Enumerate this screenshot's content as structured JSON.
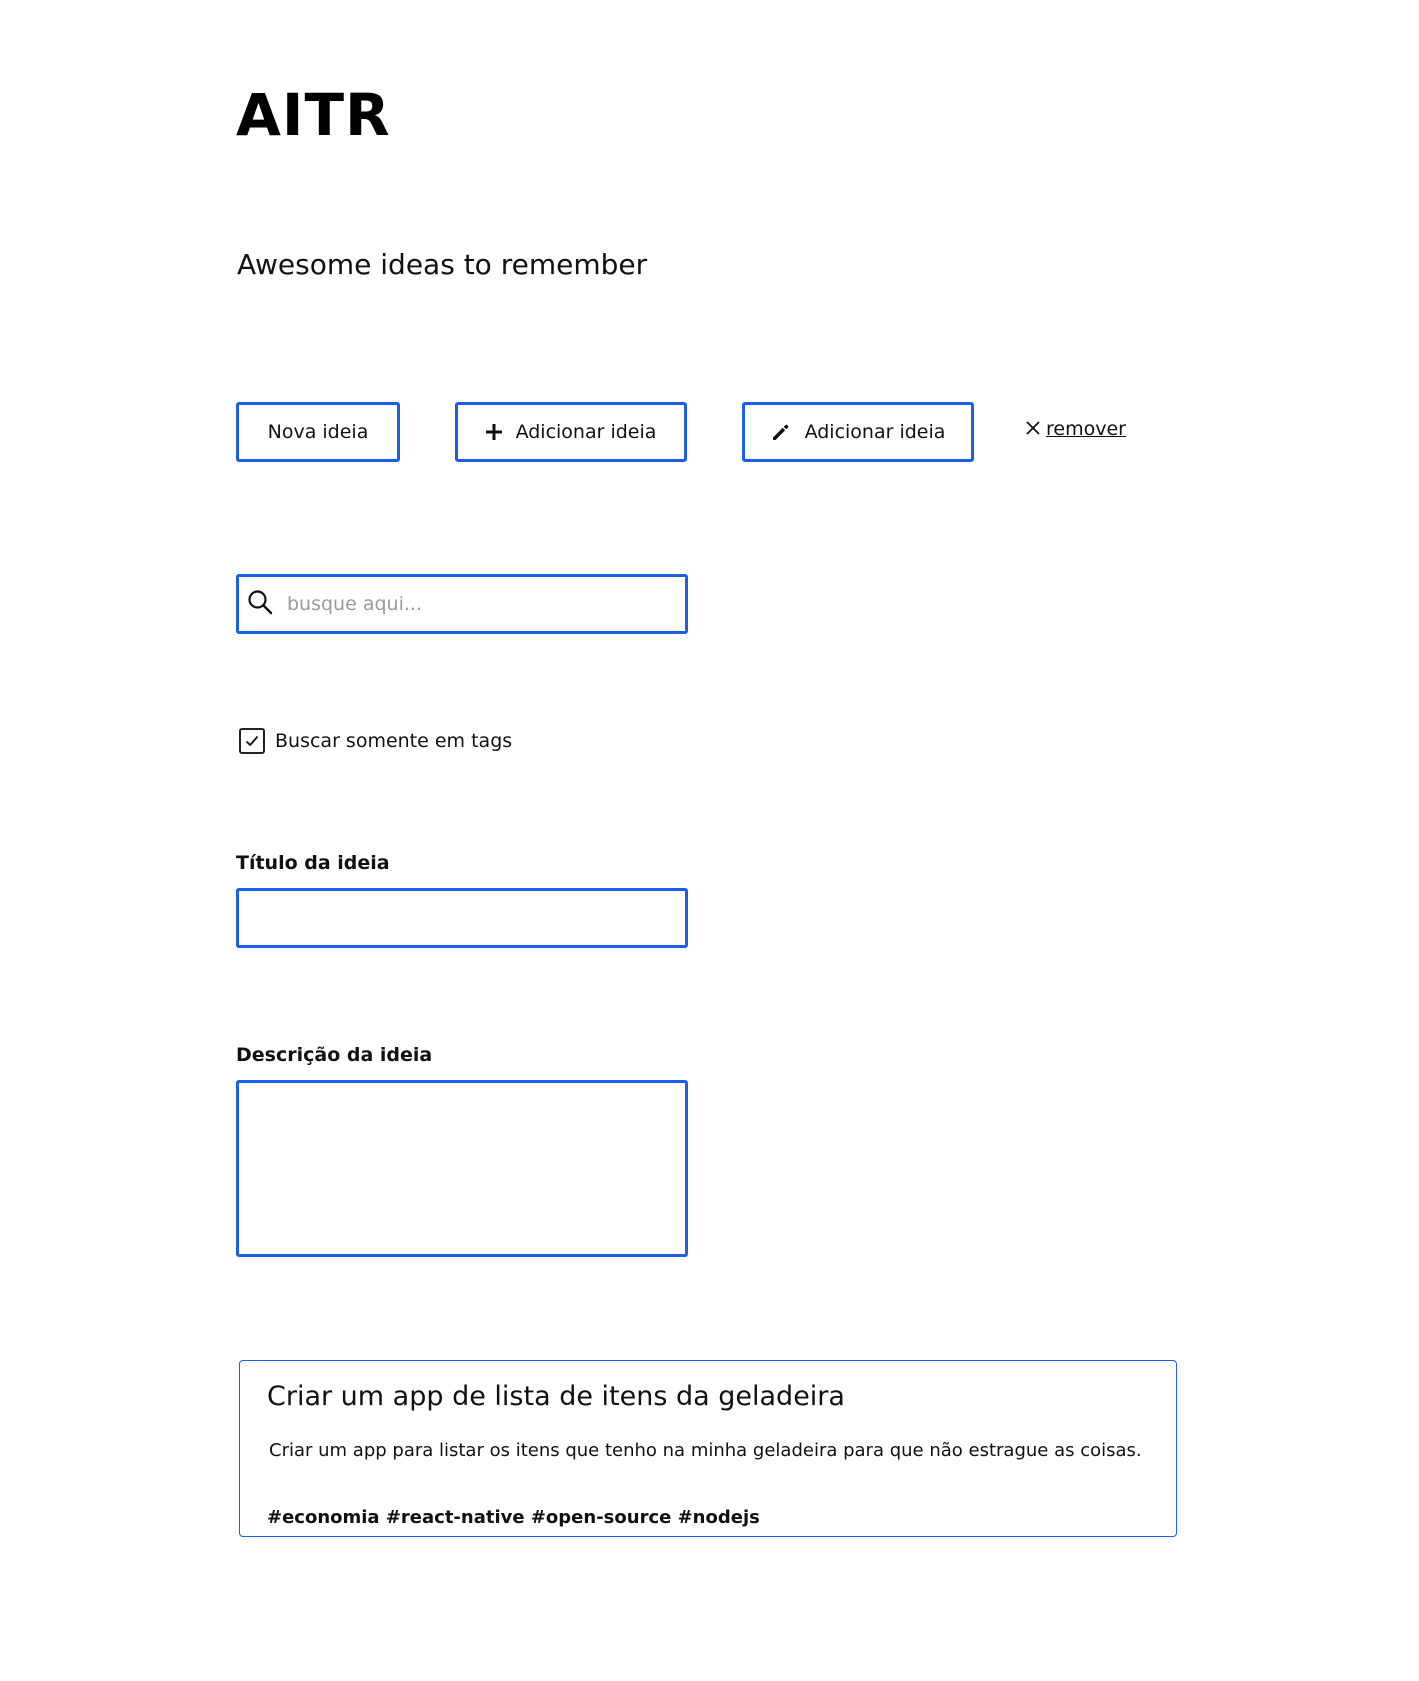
{
  "header": {
    "title": "AITR",
    "subtitle": "Awesome ideas to remember"
  },
  "toolbar": {
    "new_label": "Nova ideia",
    "add_label": "Adicionar ideia",
    "edit_label": "Adicionar ideia",
    "remove_label": "remover",
    "icons": {
      "add": "plus-icon",
      "edit": "pencil-icon",
      "remove": "close-icon"
    }
  },
  "search": {
    "placeholder": "busque aqui...",
    "value": "",
    "icon": "search-icon"
  },
  "filter": {
    "tags_only_label": "Buscar somente em tags",
    "tags_only_checked": true
  },
  "form": {
    "title_label": "Título da ideia",
    "title_value": "",
    "description_label": "Descrição da ideia",
    "description_value": ""
  },
  "ideas": [
    {
      "title": "Criar um app de lista de itens da geladeira",
      "description": "Criar um app para listar os itens que tenho na minha geladeira para que não estrague as coisas.",
      "tags": "#economia #react-native #open-source #nodejs"
    }
  ],
  "colors": {
    "accent": "#1a5fe6",
    "text": "#111111",
    "placeholder": "#9a9a9a"
  }
}
